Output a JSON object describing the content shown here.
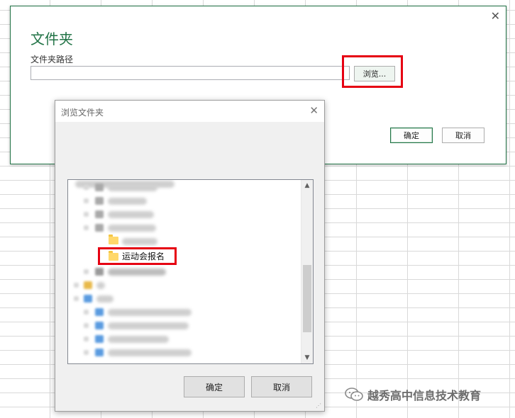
{
  "main_dialog": {
    "title": "文件夹",
    "path_label": "文件夹路径",
    "path_value": "",
    "browse_label": "浏览...",
    "ok_label": "确定",
    "cancel_label": "取消",
    "close_icon": "close-icon"
  },
  "browse_dialog": {
    "title": "浏览文件夹",
    "selected_folder": "运动会报名",
    "ok_label": "确定",
    "cancel_label": "取消",
    "close_icon": "close-icon"
  },
  "watermark": {
    "text": "越秀高中信息技术教育"
  },
  "colors": {
    "accent": "#217346",
    "highlight": "#e60012"
  }
}
